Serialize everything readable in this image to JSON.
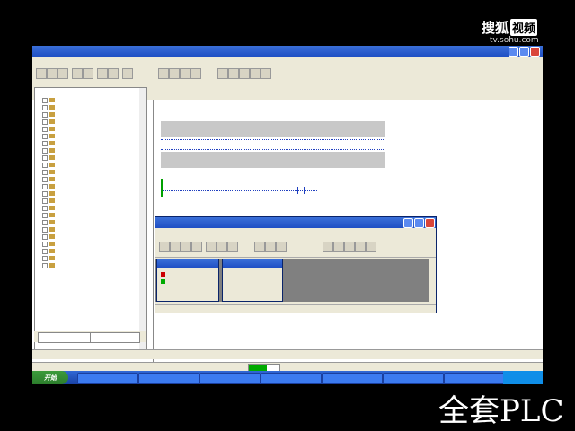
{
  "watermark": {
    "logo_text": "搜狐",
    "logo_box": "视频",
    "url": "tv.sohu.com",
    "bottom_text": "全套PLC"
  },
  "app": {
    "title": "",
    "tree": {
      "items": [
        "",
        "",
        "",
        "",
        "",
        "",
        "",
        "",
        "",
        "",
        "",
        "",
        "",
        "",
        "",
        "",
        "",
        "",
        "",
        "",
        "",
        "",
        "",
        ""
      ],
      "tabs": [
        "",
        ""
      ]
    },
    "editor": {
      "header": "",
      "network_label": "",
      "network_title": "",
      "contact_label": "",
      "coil_label": ""
    },
    "bottom_tabs": [
      "",
      "",
      "",
      "",
      "",
      ""
    ],
    "status": {
      "left_text": "",
      "progress": 0.6
    }
  },
  "dialog": {
    "title": "",
    "status_text": "",
    "sub1_title": "",
    "sub2_title": ""
  },
  "taskbar": {
    "start_label": "开始",
    "tasks": [
      "",
      "",
      "",
      "",
      "",
      "",
      "",
      "",
      "",
      "",
      ""
    ],
    "clock": ""
  },
  "colors": {
    "xp_blue": "#1f4fc4",
    "xp_green": "#3c9b3c",
    "rail_green": "#00a000"
  }
}
